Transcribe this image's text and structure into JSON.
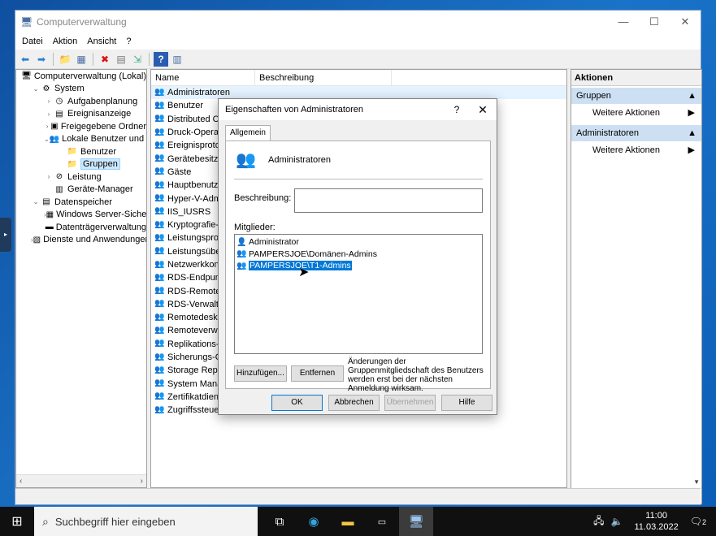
{
  "window": {
    "title": "Computerverwaltung",
    "minimize": "—",
    "maximize": "☐",
    "close": "✕"
  },
  "menu": [
    "Datei",
    "Aktion",
    "Ansicht",
    "?"
  ],
  "tree": [
    {
      "label": "Computerverwaltung (Lokal)",
      "level": 0,
      "exp": "",
      "icon": "computer-icon"
    },
    {
      "label": "System",
      "level": 1,
      "exp": "v",
      "icon": "tools-icon"
    },
    {
      "label": "Aufgabenplanung",
      "level": 2,
      "exp": ">",
      "icon": "clock-icon"
    },
    {
      "label": "Ereignisanzeige",
      "level": 2,
      "exp": ">",
      "icon": "event-log-icon"
    },
    {
      "label": "Freigegebene Ordner",
      "level": 2,
      "exp": ">",
      "icon": "shared-folder-icon"
    },
    {
      "label": "Lokale Benutzer und Gr",
      "level": 2,
      "exp": "v",
      "icon": "users-icon"
    },
    {
      "label": "Benutzer",
      "level": 3,
      "exp": "",
      "icon": "folder-icon"
    },
    {
      "label": "Gruppen",
      "level": 3,
      "exp": "",
      "icon": "folder-icon",
      "selected": true
    },
    {
      "label": "Leistung",
      "level": 2,
      "exp": ">",
      "icon": "performance-icon"
    },
    {
      "label": "Geräte-Manager",
      "level": 2,
      "exp": "",
      "icon": "device-manager-icon"
    },
    {
      "label": "Datenspeicher",
      "level": 1,
      "exp": "v",
      "icon": "storage-icon"
    },
    {
      "label": "Windows Server-Sicheru",
      "level": 2,
      "exp": ">",
      "icon": "backup-icon"
    },
    {
      "label": "Datenträgerverwaltung",
      "level": 2,
      "exp": "",
      "icon": "disk-icon"
    },
    {
      "label": "Dienste und Anwendungen",
      "level": 1,
      "exp": ">",
      "icon": "services-icon"
    }
  ],
  "list": {
    "headers": [
      "Name",
      "Beschreibung"
    ],
    "rows": [
      "Administratoren",
      "Benutzer",
      "Distributed CO",
      "Druck-Operato",
      "Ereignisprotok",
      "Gerätebesitzer",
      "Gäste",
      "Hauptbenutze",
      "Hyper-V-Adm",
      "IIS_IUSRS",
      "Kryptografie-O",
      "Leistungsproto",
      "Leistungsüber",
      "Netzwerkkonfi",
      "RDS-Endpunkt",
      "RDS-Remotezu",
      "RDS-Verwaltun",
      "Remotedeskto",
      "Remoteverwal",
      "Replikations-O",
      "Sicherungs-Op",
      "Storage Repl. A",
      "System Manag",
      "Zertifikatdiens",
      "Zugriffssteuer"
    ]
  },
  "actions": {
    "header": "Aktionen",
    "sections": [
      {
        "title": "Gruppen",
        "item": "Weitere Aktionen"
      },
      {
        "title": "Administratoren",
        "item": "Weitere Aktionen"
      }
    ]
  },
  "dialog": {
    "title": "Eigenschaften von Administratoren",
    "help": "?",
    "close": "✕",
    "tab": "Allgemein",
    "group_name": "Administratoren",
    "description_label": "Beschreibung:",
    "description_value": "",
    "members_label": "Mitglieder:",
    "members": [
      {
        "name": "Administrator",
        "icon": "user-icon"
      },
      {
        "name": "PAMPERSJOE\\Domänen-Admins",
        "icon": "group-icon"
      },
      {
        "name": "PAMPERSJOE\\T1-Admins",
        "icon": "group-icon",
        "selected": true
      }
    ],
    "add_button": "Hinzufügen...",
    "remove_button": "Entfernen",
    "note": "Änderungen der Gruppenmitgliedschaft des Benutzers werden erst bei der nächsten Anmeldung wirksam.",
    "ok": "OK",
    "cancel": "Abbrechen",
    "apply": "Übernehmen",
    "help_button": "Hilfe"
  },
  "taskbar": {
    "search_placeholder": "Suchbegriff hier eingeben",
    "time": "11:00",
    "date": "11.03.2022",
    "notifications": "2"
  }
}
